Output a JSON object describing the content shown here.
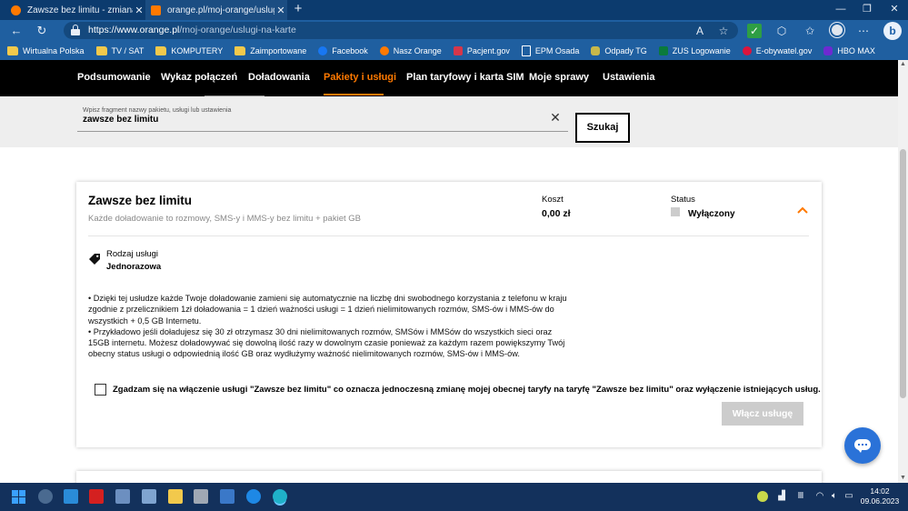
{
  "browser": {
    "tabs": [
      {
        "title": "Zawsze bez limitu - zmiana taryf...",
        "active": false,
        "favicon_color": "#ff7900"
      },
      {
        "title": "orange.pl/moj-orange/uslugi-na-...",
        "active": true,
        "favicon_color": "#ff7900"
      }
    ],
    "new_tab_icon": "plus-icon",
    "url_host": "https://www.orange.pl",
    "url_path": "/moj-orange/uslugi-na-karte",
    "bookmarks": [
      {
        "label": "Wirtualna Polska",
        "icon": "folder-icon"
      },
      {
        "label": "TV / SAT",
        "icon": "folder-icon"
      },
      {
        "label": "KOMPUTERY",
        "icon": "folder-icon"
      },
      {
        "label": "Zaimportowane",
        "icon": "folder-icon"
      },
      {
        "label": "Facebook",
        "icon": "facebook-icon"
      },
      {
        "label": "Nasz Orange",
        "icon": "orange-icon"
      },
      {
        "label": "Pacjent.gov",
        "icon": "pacjent-icon"
      },
      {
        "label": "EPM Osada",
        "icon": "document-icon"
      },
      {
        "label": "Odpady TG",
        "icon": "odpady-icon"
      },
      {
        "label": "ZUS Logowanie",
        "icon": "zus-icon"
      },
      {
        "label": "E-obywatel.gov",
        "icon": "eagle-icon"
      },
      {
        "label": "HBO MAX",
        "icon": "hbo-icon"
      }
    ]
  },
  "nav": {
    "items": [
      "Podsumowanie",
      "Wykaz połączeń",
      "Doładowania",
      "Pakiety i usługi",
      "Plan taryfowy i karta SIM",
      "Moje sprawy",
      "Ustawienia"
    ],
    "active": "Pakiety i usługi"
  },
  "search": {
    "label": "Wpisz fragment nazwy pakietu, usługi lub ustawienia",
    "value": "zawsze bez limitu",
    "button": "Szukaj"
  },
  "card": {
    "title": "Zawsze bez limitu",
    "subtitle": "Każde doładowanie to rozmowy, SMS-y i MMS-y bez limitu + pakiet GB",
    "cost_label": "Koszt",
    "cost_value": "0,00 zł",
    "status_label": "Status",
    "status_value": "Wyłączony",
    "type_label": "Rodzaj usługi",
    "type_value": "Jednorazowa",
    "description": [
      "• Dzięki tej usłudze każde Twoje doładowanie zamieni się automatycznie na liczbę dni swobodnego korzystania z telefonu w kraju zgodnie z przelicznikiem 1zł doładowania = 1 dzień ważności usługi = 1 dzień nielimitowanych rozmów, SMS-ów i MMS-ów do wszystkich + 0,5 GB Internetu.",
      "• Przykładowo jeśli doładujesz się 30 zł otrzymasz 30 dni nielimitowanych rozmów, SMSów i MMSów do wszystkich sieci oraz 15GB internetu. Możesz doładowywać się dowolną ilość razy w dowolnym czasie ponieważ za każdym razem powiększymy Twój obecny status usługi o odpowiednią ilość GB oraz wydłużymy ważność nielimitowanych rozmów, SMS-ów i MMS-ów."
    ],
    "consent": "Zgadzam się na włączenie usługi \"Zawsze bez limitu\" co oznacza jednoczesną zmianę mojej obecnej taryfy na taryfę \"Zawsze bez limitu\" oraz wyłączenie istniejących usług.",
    "enable_button": "Włącz usługę"
  },
  "colors": {
    "accent": "#ff7900",
    "nav_bg": "#000000",
    "button_disabled": "#cccccc",
    "chat": "#2a72d8"
  },
  "taskbar": {
    "time": "14:02",
    "date": "09.06.2023"
  }
}
